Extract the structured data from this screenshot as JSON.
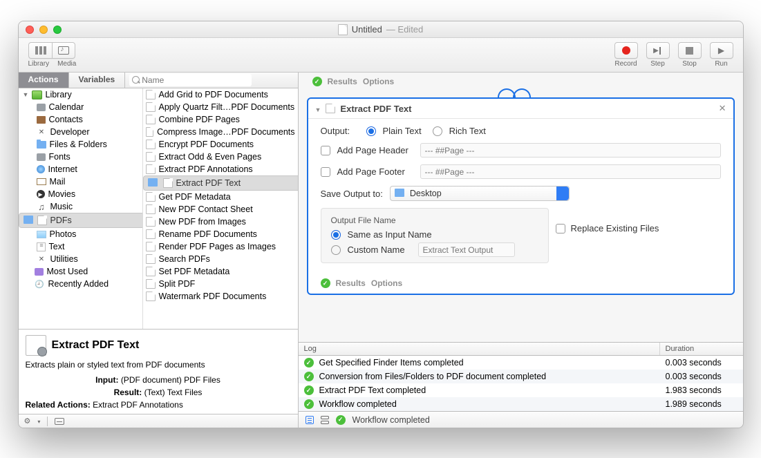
{
  "window": {
    "title": "Untitled",
    "edited": "— Edited"
  },
  "toolbar": {
    "left": [
      {
        "name": "library-button",
        "label": "Library"
      },
      {
        "name": "media-button",
        "label": "Media"
      }
    ],
    "right": [
      {
        "name": "record-button",
        "label": "Record"
      },
      {
        "name": "step-button",
        "label": "Step"
      },
      {
        "name": "stop-button",
        "label": "Stop"
      },
      {
        "name": "run-button",
        "label": "Run"
      }
    ]
  },
  "leftTabs": {
    "actions": "Actions",
    "variables": "Variables"
  },
  "search": {
    "placeholder": "Name"
  },
  "sidebar": {
    "root": "Library",
    "items": [
      "Calendar",
      "Contacts",
      "Developer",
      "Files & Folders",
      "Fonts",
      "Internet",
      "Mail",
      "Movies",
      "Music",
      "PDFs",
      "Photos",
      "Text",
      "Utilities"
    ],
    "selected": "PDFs",
    "extras": [
      "Most Used",
      "Recently Added"
    ]
  },
  "actions": {
    "items": [
      "Add Grid to PDF Documents",
      "Apply Quartz Filt…PDF Documents",
      "Combine PDF Pages",
      "Compress Image…PDF Documents",
      "Encrypt PDF Documents",
      "Extract Odd & Even Pages",
      "Extract PDF Annotations",
      "Extract PDF Text",
      "Get PDF Metadata",
      "New PDF Contact Sheet",
      "New PDF from Images",
      "Rename PDF Documents",
      "Render PDF Pages as Images",
      "Search PDFs",
      "Set PDF Metadata",
      "Split PDF",
      "Watermark PDF Documents"
    ],
    "selected": "Extract PDF Text"
  },
  "description": {
    "title": "Extract PDF Text",
    "summary": "Extracts plain or styled text from PDF documents",
    "input_label": "Input:",
    "input": "(PDF document) PDF Files",
    "result_label": "Result:",
    "result": "(Text) Text Files",
    "related_label": "Related Actions:",
    "related": "Extract PDF Annotations"
  },
  "workflowTop": {
    "results": "Results",
    "options": "Options"
  },
  "card": {
    "title": "Extract PDF Text",
    "output_label": "Output:",
    "radio_plain": "Plain Text",
    "radio_rich": "Rich Text",
    "add_header": "Add Page Header",
    "add_footer": "Add Page Footer",
    "placeholder_token": "--- ##Page ---",
    "save_output_label": "Save Output to:",
    "save_output_value": "Desktop",
    "filename_group": "Output File Name",
    "same_as_input": "Same as Input Name",
    "custom_name": "Custom Name",
    "custom_placeholder": "Extract Text Output",
    "replace_existing": "Replace Existing Files",
    "results": "Results",
    "options": "Options"
  },
  "log": {
    "columns": {
      "log": "Log",
      "duration": "Duration"
    },
    "rows": [
      {
        "msg": "Get Specified Finder Items completed",
        "dur": "0.003 seconds"
      },
      {
        "msg": "Conversion from Files/Folders to PDF document completed",
        "dur": "0.003 seconds"
      },
      {
        "msg": "Extract PDF Text completed",
        "dur": "1.983 seconds"
      },
      {
        "msg": "Workflow completed",
        "dur": "1.989 seconds"
      }
    ]
  },
  "status": "Workflow completed"
}
